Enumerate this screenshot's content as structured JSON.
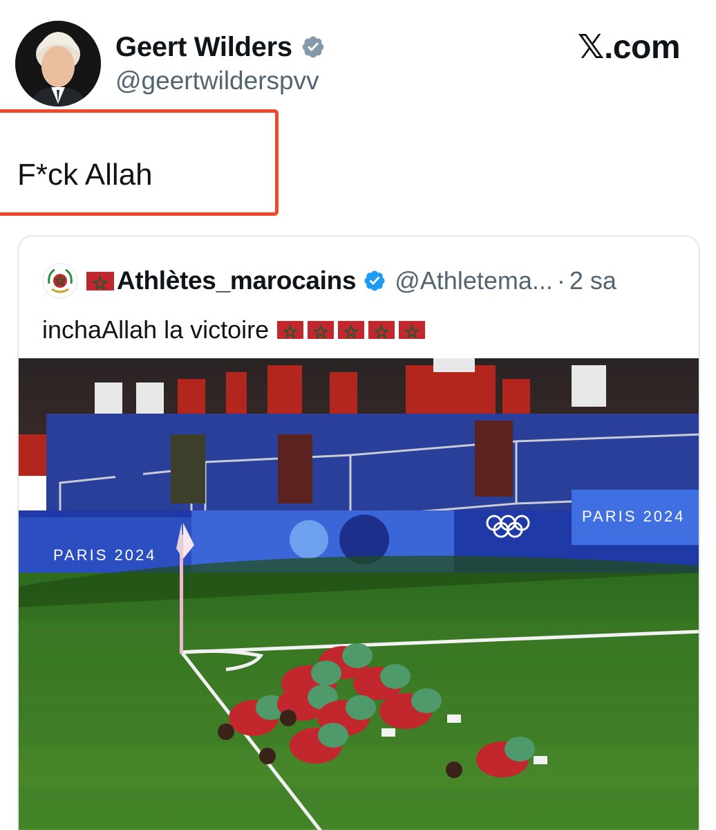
{
  "post": {
    "author_name": "Geert Wilders",
    "author_handle": "@geertwilderspvv",
    "verified_badge_icon": "verified-badge-gray-icon",
    "brand": "𝕏.com",
    "text": "F*ck Allah",
    "highlight_color": "#f0492a"
  },
  "quoted_post": {
    "author_name": "Athlètes_marocains",
    "author_handle": "@Athletema...",
    "separator": "·",
    "time": "2 sa",
    "text": "inchaAllah la victoire",
    "name_flag_icon": "morocco-flag-icon",
    "text_flag_count": 5,
    "verified_badge_icon": "verified-badge-blue-icon",
    "photo": {
      "banner_left": "PARIS 2024",
      "banner_right": "PARIS 2024",
      "rings_icon": "olympic-rings-icon"
    }
  },
  "colors": {
    "text_primary": "#0f1419",
    "text_secondary": "#536471",
    "verified_blue": "#1d9bf0",
    "verified_gray": "#829aab",
    "morocco_red": "#c1272d",
    "morocco_green": "#006233"
  }
}
